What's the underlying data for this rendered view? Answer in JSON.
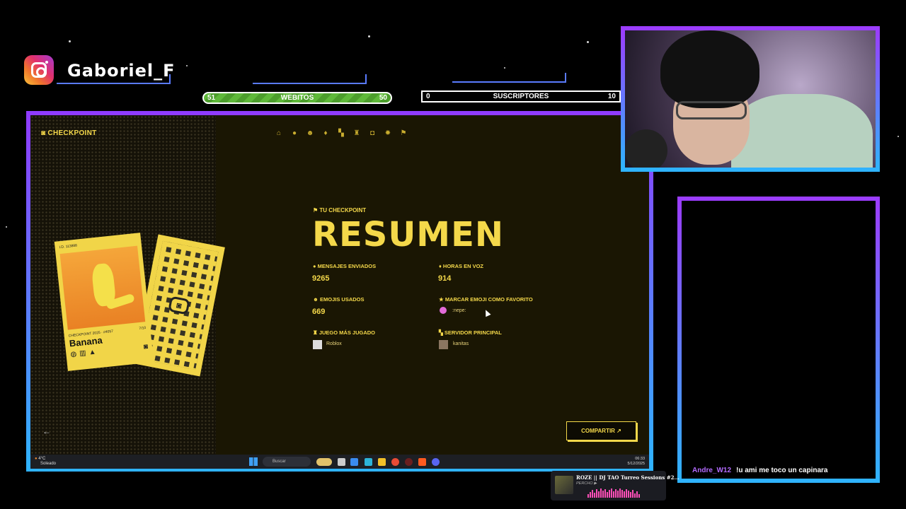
{
  "overlay": {
    "instagram_handle": "Gaboriel_F",
    "goal_webitos": {
      "label": "WEBITOS",
      "current": "51",
      "target": "50"
    },
    "goal_subs": {
      "label": "SUSCRIPTORES",
      "current": "0",
      "target": "10"
    }
  },
  "app": {
    "brand": "CHECKPOINT",
    "nav_icons": [
      "home-icon",
      "chat-icon",
      "emoji-icon",
      "mic-icon",
      "server-icon",
      "game-icon",
      "controller-icon",
      "settings-icon",
      "flag-icon"
    ],
    "eyebrow": "TU CHECKPOINT",
    "title": "RESUMEN",
    "stats": {
      "messages": {
        "label": "MENSAJES ENVIADOS",
        "value": "9265"
      },
      "voice_hours": {
        "label": "HORAS EN VOZ",
        "value": "914"
      },
      "emojis": {
        "label": "EMOJIS USADOS",
        "value": "669"
      },
      "fav_emoji": {
        "label": "MARCAR EMOJI COMO FAVORITO",
        "value": ":nepe:"
      },
      "top_game": {
        "label": "JUEGO MÁS JUGADO",
        "value": "Roblox"
      },
      "top_server": {
        "label": "SERVIDOR PRINCIPAL",
        "value": "kanitas"
      }
    },
    "share_label": "COMPARTIR ↗",
    "card": {
      "id": "I.D. 113888",
      "series": "CHECKPOINT 2025 · #4057",
      "rating": "7/10",
      "name": "Banana"
    }
  },
  "taskbar": {
    "weather": "4°C",
    "weather_sub": "Soleado",
    "search_placeholder": "Buscar",
    "time": "06:33",
    "date": "5/12/2025"
  },
  "chat": {
    "username": "Andre_W12",
    "message": "!u ami me toco un capinara"
  },
  "now_playing": {
    "title": "ROZE || DJ TAO Turreo Sessions #2...",
    "subtitle": "PERCHO ▶"
  }
}
